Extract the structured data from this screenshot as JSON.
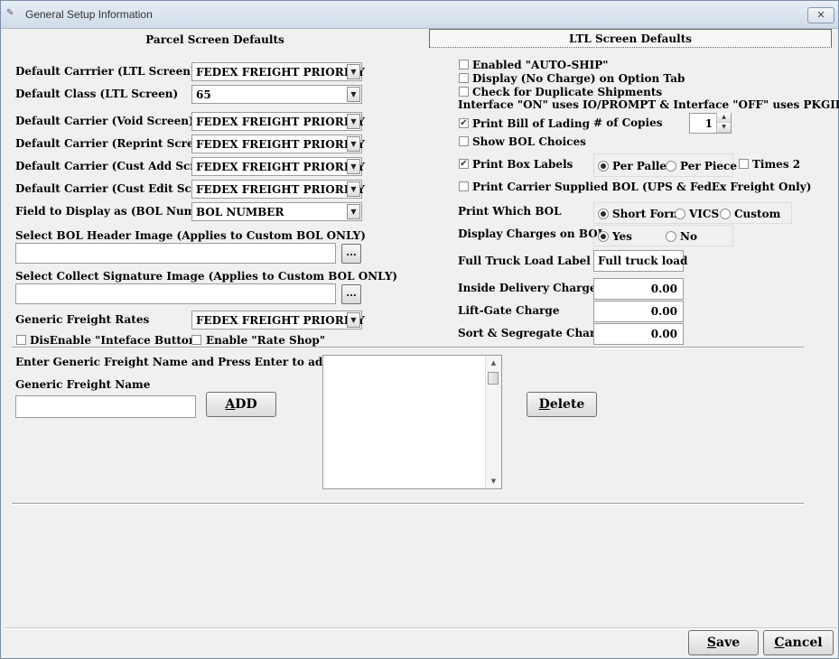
{
  "window": {
    "title": "General Setup Information",
    "close_glyph": "✕"
  },
  "tabs": {
    "parcel": "Parcel Screen Defaults",
    "ltl": "LTL Screen Defaults"
  },
  "left": {
    "default_carrier_ltl": {
      "label": "Default Carrrier (LTL Screen)",
      "value": "FEDEX FREIGHT PRIORITY"
    },
    "default_class_ltl": {
      "label": "Default Class (LTL Screen)",
      "value": "65"
    },
    "default_carrier_void": {
      "label": "Default Carrier (Void Screen)",
      "value": "FEDEX FREIGHT PRIORITY"
    },
    "default_carrier_reprint": {
      "label": "Default Carrier (Reprint Screen)",
      "value": "FEDEX FREIGHT PRIORITY"
    },
    "default_carrier_custadd": {
      "label": "Default Carrier (Cust Add Screen)",
      "value": "FEDEX FREIGHT PRIORITY"
    },
    "default_carrier_custedit": {
      "label": "Default Carrier (Cust Edit Screen)",
      "value": "FEDEX FREIGHT PRIORITY"
    },
    "field_display_bol": {
      "label": "Field to Display as (BOL Number)",
      "value": "BOL NUMBER"
    },
    "bol_header_image": {
      "label": "Select BOL Header Image (Applies to Custom BOL ONLY)",
      "value": "",
      "browse": "..."
    },
    "collect_signature_image": {
      "label": "Select Collect Signature Image (Applies to Custom BOL ONLY)",
      "value": "",
      "browse": "..."
    },
    "generic_freight_rates": {
      "label": "Generic Freight Rates",
      "value": "FEDEX FREIGHT PRIORITY"
    },
    "disable_interface_button": {
      "label": "DisEnable \"Inteface Button\"",
      "checked": false
    },
    "enable_rate_shop": {
      "label": "Enable \"Rate Shop\"",
      "checked": false
    }
  },
  "generic": {
    "instruction": "Enter Generic Freight Name and Press Enter to add to List",
    "name_label": "Generic Freight Name",
    "name_value": "",
    "add_prefix": "A",
    "add_rest": "DD",
    "delete_prefix": "D",
    "delete_rest": "elete",
    "list_items": []
  },
  "right": {
    "auto_ship": {
      "label": "Enabled \"AUTO-SHIP\"",
      "checked": false
    },
    "display_no_charge": {
      "label": "Display (No Charge) on Option Tab",
      "checked": false
    },
    "check_duplicates": {
      "label": "Check for Duplicate Shipments",
      "checked": false
    },
    "interface_note": "Interface \"ON\" uses IO/PROMPT & Interface \"OFF\" uses PKGID",
    "print_bol": {
      "label": "Print Bill of Lading",
      "checked": true
    },
    "copies": {
      "label": "# of Copies",
      "value": "1"
    },
    "show_bol_choices": {
      "label": "Show BOL Choices",
      "checked": false
    },
    "print_box_labels": {
      "label": "Print Box Labels",
      "checked": true
    },
    "per_pallet": {
      "label": "Per Pallet",
      "selected": true
    },
    "per_piece": {
      "label": "Per Piece",
      "selected": false
    },
    "times2": {
      "label": "Times 2",
      "checked": false
    },
    "print_carrier_bol": {
      "label": "Print Carrier Supplied BOL (UPS & FedEx Freight Only)",
      "checked": false
    },
    "print_which_bol": {
      "label": "Print Which BOL",
      "options": [
        "Short Form",
        "VICS",
        "Custom"
      ],
      "selected": "Short Form"
    },
    "display_charges": {
      "label": "Display Charges on BOL",
      "options": [
        "Yes",
        "No"
      ],
      "selected": "Yes"
    },
    "ftl_label": {
      "label": "Full Truck Load Label",
      "value": "Full truck load"
    },
    "inside_delivery": {
      "label": "Inside Delivery Charge",
      "value": "0.00"
    },
    "lift_gate": {
      "label": "Lift-Gate Charge",
      "value": "0.00"
    },
    "sort_segregate": {
      "label": "Sort & Segregate Charge",
      "value": "0.00"
    }
  },
  "footer": {
    "save_prefix": "S",
    "save_rest": "ave",
    "cancel_prefix": "C",
    "cancel_rest": "ancel"
  },
  "icons": {
    "check": "✔",
    "dropdown": "▼",
    "up": "▲",
    "down": "▼"
  }
}
